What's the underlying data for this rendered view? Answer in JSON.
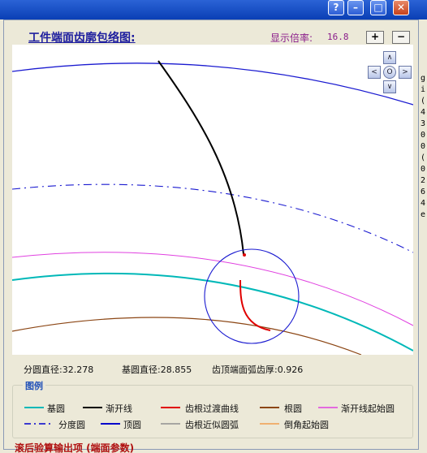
{
  "window": {
    "buttons": [
      "?",
      "–",
      "□",
      "✕"
    ]
  },
  "side_text": "g\ni\n(\n4\n3\n0\n0\n(\n0\n2\n6\n4\ne",
  "dialog": {
    "title": "工件端面齿廓包络图:",
    "zoom_label": "显示倍率:",
    "zoom_value": "16.8",
    "zoom_in": "+",
    "zoom_out": "−"
  },
  "nav": {
    "up": "∧",
    "down": "∨",
    "left": "<",
    "right": ">",
    "center": "O"
  },
  "readouts": {
    "pitch_diameter": "分圆直径:32.278",
    "base_diameter": "基圆直径:28.855",
    "tip_thickness": "齿顶端面弧齿厚:0.926"
  },
  "legend": {
    "title": "图例",
    "items": [
      {
        "label": "基圆",
        "color": "#00b8b8",
        "style": "solid"
      },
      {
        "label": "渐开线",
        "color": "#000000",
        "style": "solid"
      },
      {
        "label": "齿根过渡曲线",
        "color": "#e00000",
        "style": "solid"
      },
      {
        "label": "根圆",
        "color": "#8b4513",
        "style": "solid"
      },
      {
        "label": "渐开线起始圆",
        "color": "#e040e0",
        "style": "solid"
      },
      {
        "label": "分度圆",
        "color": "#0000cc",
        "style": "dashdot"
      },
      {
        "label": "顶圆",
        "color": "#0000cc",
        "style": "solid"
      },
      {
        "label": "齿根近似圆弧",
        "color": "#909090",
        "style": "solid"
      },
      {
        "label": "倒角起始圆",
        "color": "#f0b070",
        "style": "solid"
      }
    ]
  },
  "bottom_text": "滚后验算输出项 (端面参数)"
}
